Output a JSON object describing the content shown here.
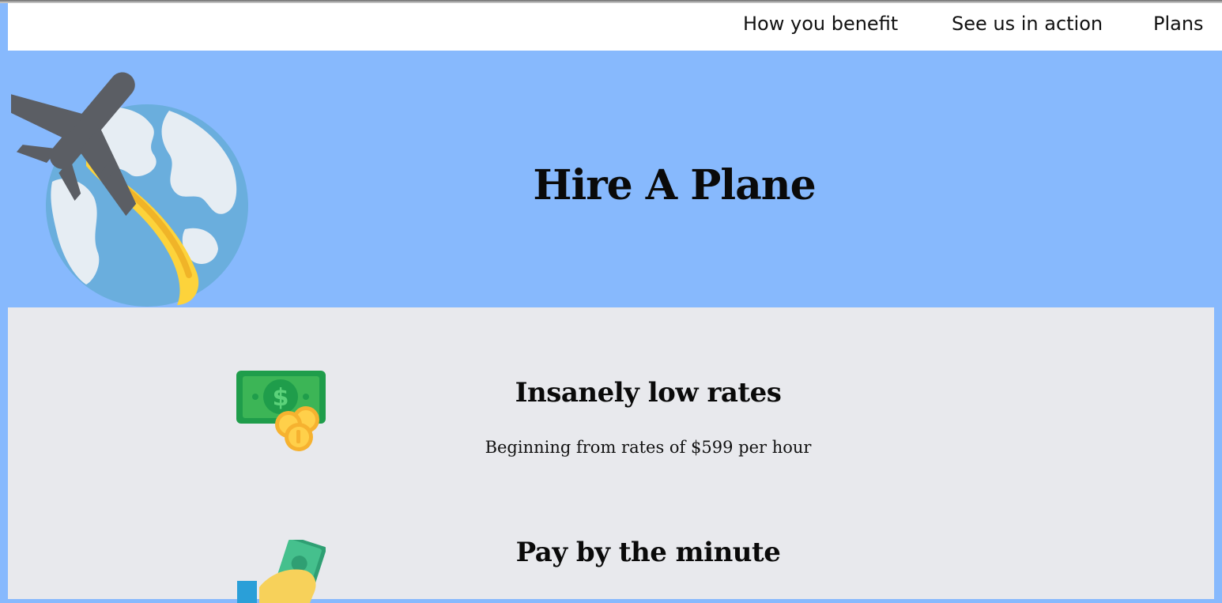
{
  "nav": {
    "items": [
      {
        "label": "How you benefit"
      },
      {
        "label": "See us in action"
      },
      {
        "label": "Plans"
      }
    ]
  },
  "hero": {
    "title": "Hire A Plane",
    "illustration": "plane-over-globe-icon"
  },
  "features": [
    {
      "icon": "money-coins-icon",
      "title": "Insanely low rates",
      "description": "Beginning from rates of $599 per hour"
    },
    {
      "icon": "hand-cash-icon",
      "title": "Pay by the minute"
    }
  ],
  "colors": {
    "hero_background": "#87b9fd",
    "features_background": "#e8e9ed",
    "navbar_background": "#ffffff",
    "plane": "#5b5e64",
    "contrail": "#fdd33b",
    "globe": "#6aaedd"
  }
}
